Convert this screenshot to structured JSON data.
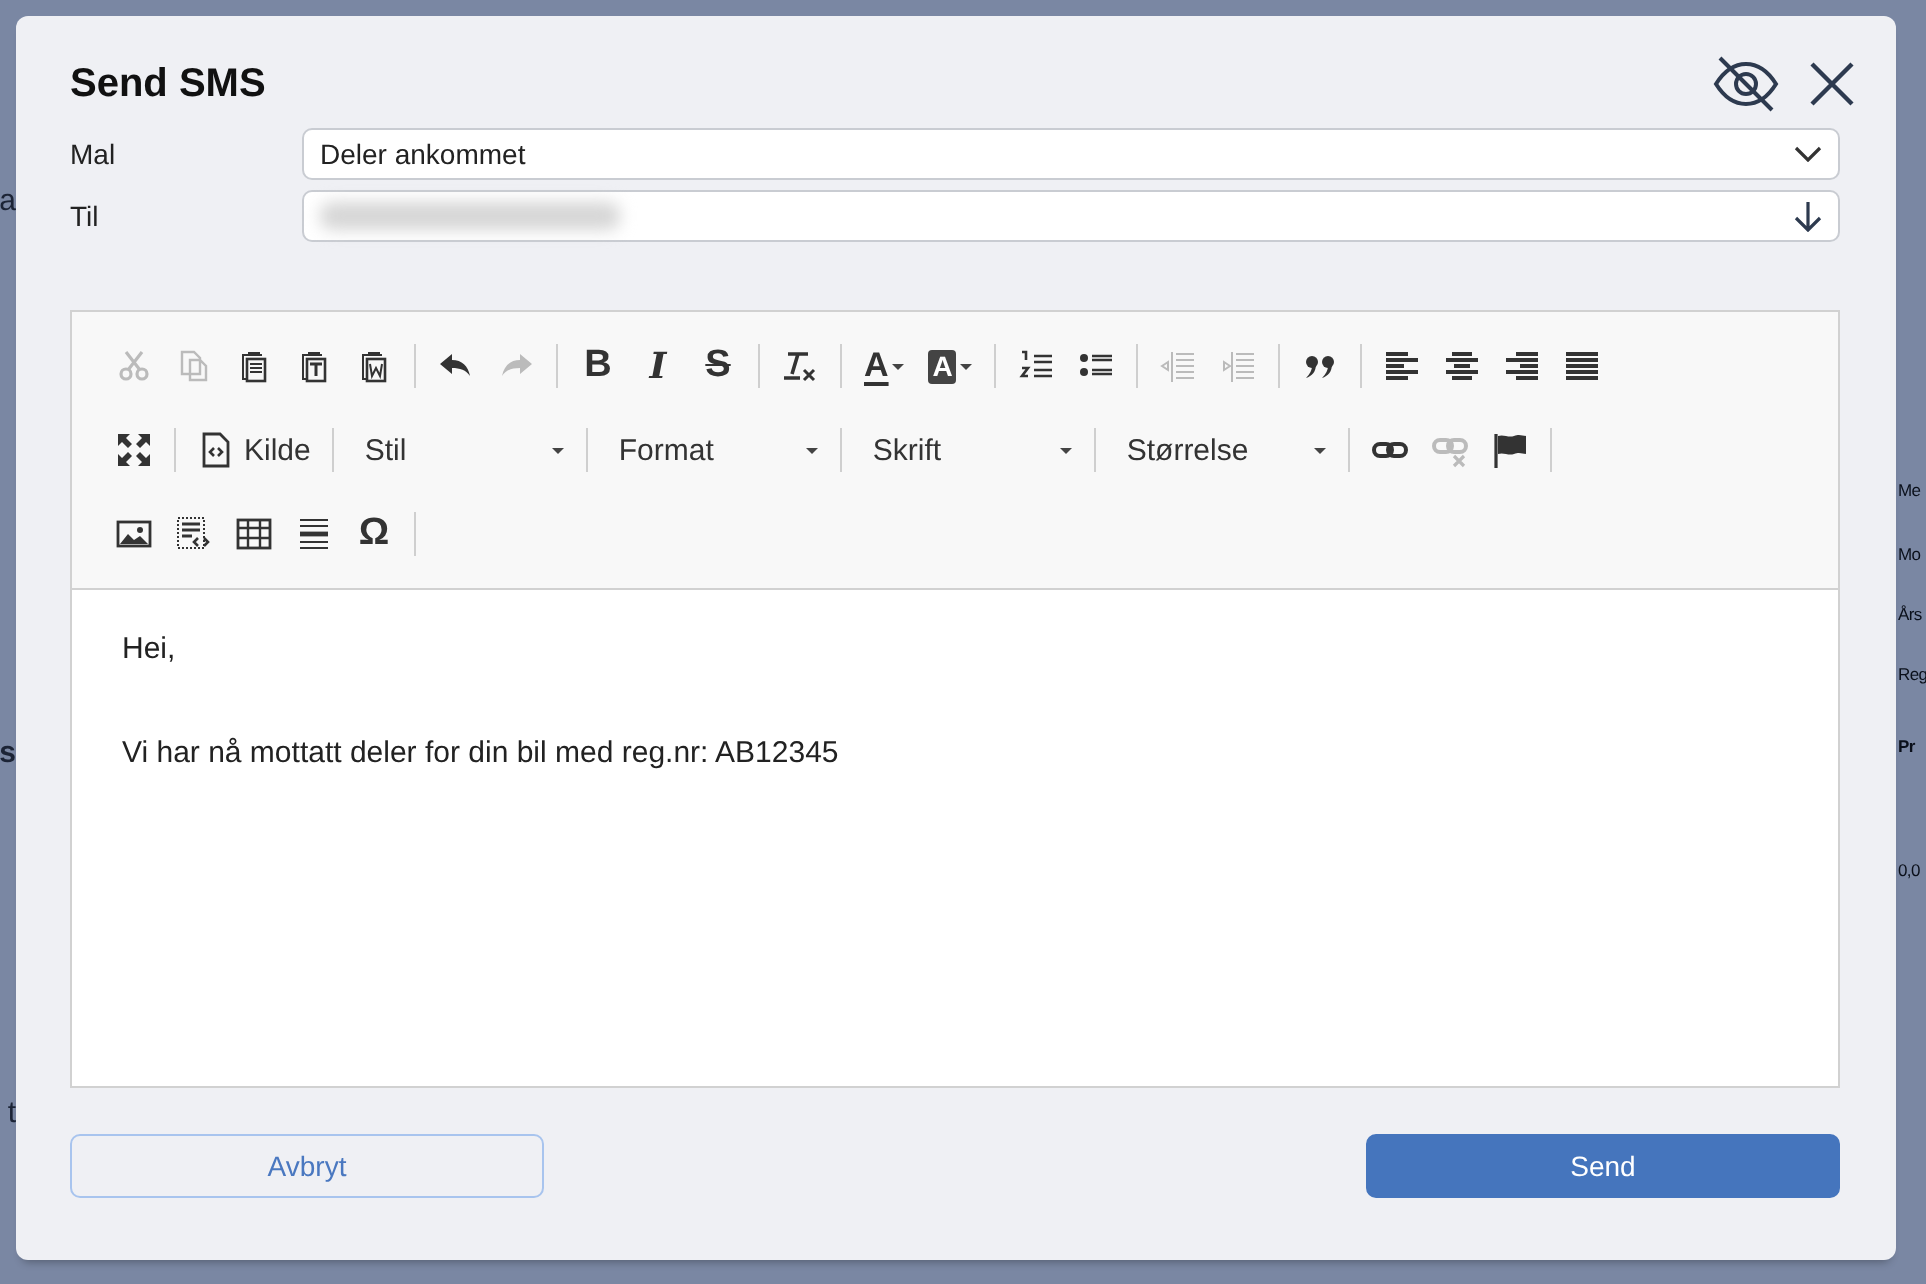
{
  "background": {
    "left_fragments": [
      "a",
      "s",
      "t"
    ],
    "right_fragments": [
      "Me",
      "Mo",
      "Års",
      "Reg",
      "Pr",
      "0,0"
    ]
  },
  "dialog": {
    "title": "Send SMS"
  },
  "fields": [
    {
      "label": "Mal",
      "kind": "select",
      "value": "Deler ankommet"
    },
    {
      "label": "Til",
      "kind": "recipient"
    }
  ],
  "toolbar": [
    [
      {
        "kind": "cut",
        "disabled": true
      },
      {
        "kind": "copy",
        "disabled": true
      },
      {
        "kind": "paste",
        "disabled": false
      },
      {
        "kind": "paste_text",
        "disabled": false
      },
      {
        "kind": "paste_word",
        "disabled": false
      },
      {
        "kind": "separator"
      },
      {
        "kind": "undo",
        "disabled": false
      },
      {
        "kind": "redo",
        "disabled": true
      },
      {
        "kind": "separator"
      },
      {
        "kind": "bold",
        "glyph": "B",
        "disabled": false
      },
      {
        "kind": "italic",
        "glyph": "I",
        "disabled": false
      },
      {
        "kind": "strike",
        "glyph": "S",
        "disabled": false
      },
      {
        "kind": "separator"
      },
      {
        "kind": "clear_format",
        "disabled": false
      },
      {
        "kind": "separator"
      },
      {
        "kind": "text_color",
        "glyph": "A",
        "disabled": false
      },
      {
        "kind": "bg_color",
        "glyph": "A",
        "disabled": false
      },
      {
        "kind": "separator"
      },
      {
        "kind": "numbered_list",
        "disabled": false
      },
      {
        "kind": "bullet_list",
        "disabled": false
      },
      {
        "kind": "separator"
      },
      {
        "kind": "outdent",
        "disabled": true
      },
      {
        "kind": "indent",
        "disabled": true
      },
      {
        "kind": "separator"
      },
      {
        "kind": "quote",
        "disabled": false
      },
      {
        "kind": "separator"
      },
      {
        "kind": "align_left",
        "disabled": false
      },
      {
        "kind": "align_center",
        "disabled": false
      },
      {
        "kind": "align_right",
        "disabled": false
      },
      {
        "kind": "justify",
        "disabled": false
      }
    ],
    [
      {
        "kind": "maximize",
        "disabled": false
      },
      {
        "kind": "separator"
      },
      {
        "kind": "source",
        "label": "Kilde",
        "disabled": false
      },
      {
        "kind": "separator"
      },
      {
        "kind": "combo",
        "label": "Stil"
      },
      {
        "kind": "separator"
      },
      {
        "kind": "combo",
        "label": "Format"
      },
      {
        "kind": "separator"
      },
      {
        "kind": "combo",
        "label": "Skrift"
      },
      {
        "kind": "separator"
      },
      {
        "kind": "combo",
        "label": "Størrelse"
      },
      {
        "kind": "separator"
      },
      {
        "kind": "link",
        "disabled": false
      },
      {
        "kind": "unlink",
        "disabled": true
      },
      {
        "kind": "anchor",
        "disabled": false
      },
      {
        "kind": "separator"
      }
    ],
    [
      {
        "kind": "image",
        "disabled": false
      },
      {
        "kind": "template",
        "disabled": false
      },
      {
        "kind": "table",
        "disabled": false
      },
      {
        "kind": "rule",
        "disabled": false
      },
      {
        "kind": "special_char",
        "glyph": "Ω",
        "disabled": false
      },
      {
        "kind": "separator"
      }
    ]
  ],
  "body": [
    "Hei,",
    "Vi har nå mottatt deler for din bil med reg.nr: AB12345"
  ],
  "buttons": [
    {
      "label": "Avbryt",
      "kind": "secondary"
    },
    {
      "label": "Send",
      "kind": "primary"
    }
  ]
}
